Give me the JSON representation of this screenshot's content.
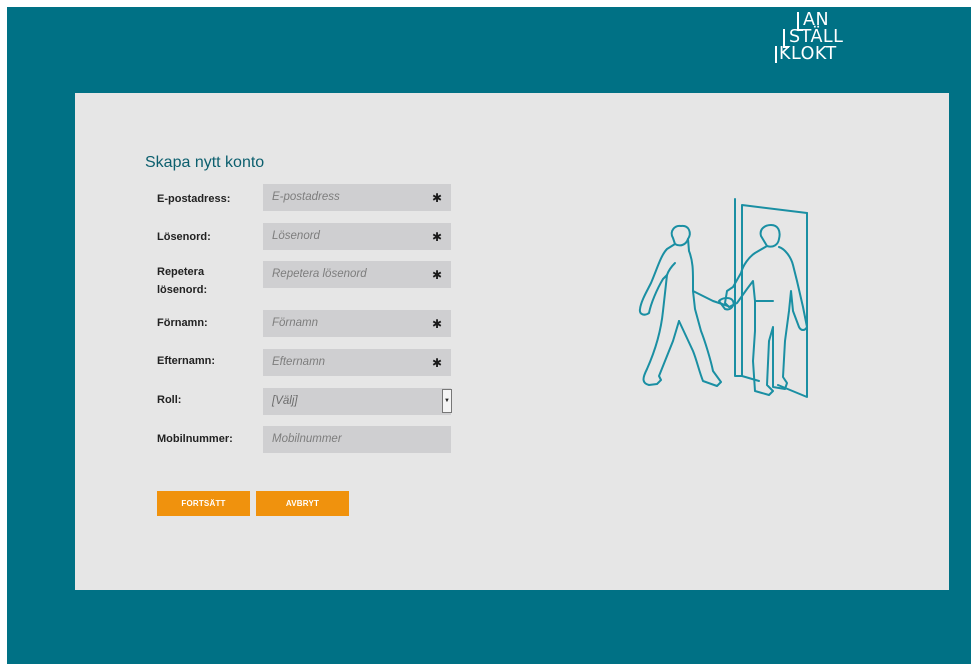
{
  "brand": {
    "lines": [
      "AN",
      "STÄLL",
      "KLOKT"
    ]
  },
  "form": {
    "title": "Skapa nytt konto",
    "fields": [
      {
        "label": "E-postadress:",
        "placeholder": "E-postadress",
        "required": "✱"
      },
      {
        "label": "Lösenord:",
        "placeholder": "Lösenord",
        "required": "✱"
      },
      {
        "label_line1": "Repetera",
        "label_line2": "lösenord:",
        "placeholder": "Repetera lösenord",
        "required": "✱"
      },
      {
        "label": "Förnamn:",
        "placeholder": "Förnamn",
        "required": "✱"
      },
      {
        "label": "Efternamn:",
        "placeholder": "Efternamn",
        "required": "✱"
      },
      {
        "label": "Roll:",
        "value": "[Välj]"
      },
      {
        "label": "Mobilnummer:",
        "placeholder": "Mobilnummer"
      }
    ],
    "buttons": {
      "continue": "FORTSÄTT",
      "cancel": "AVBRYT"
    }
  },
  "colors": {
    "background": "#007185",
    "panel": "#e6e6e6",
    "field": "#cfcfd1",
    "button": "#f0920d",
    "illustration": "#1a8fa3"
  },
  "illustration": {
    "icon": "handshake-at-door-icon"
  }
}
